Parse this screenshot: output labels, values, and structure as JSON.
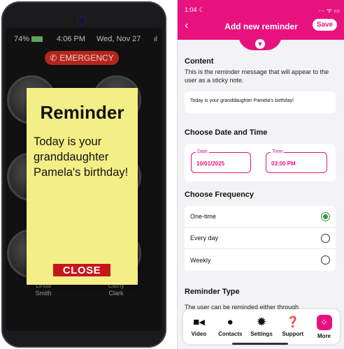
{
  "device": {
    "status": {
      "battery": "74%",
      "time": "4:06 PM",
      "date": "Wed, Nov 27",
      "signal": "ıl"
    },
    "emergency_label": "EMERGENCY",
    "contacts": [
      {
        "name": "Linda\nSmith"
      },
      {
        "name": "Cathy\nClark"
      }
    ],
    "sticky": {
      "title": "Reminder",
      "message": "Today is your granddaughter Pamela's birthday!",
      "close_label": "CLOSE"
    }
  },
  "app": {
    "status_bar": {
      "time": "1:04",
      "icons": "···  ᯤ ▭"
    },
    "header": {
      "back": "‹",
      "title": "Add new reminder",
      "save_label": "Save"
    },
    "content": {
      "title": "Content",
      "desc": "This is the reminder message that will appear to the user as a sticky note.",
      "message": "Today is your granddaughter Pamela's birthday!"
    },
    "datetime": {
      "title": "Choose Date and Time",
      "date_label": "Date",
      "date_value": "10/01/2025",
      "time_label": "Time",
      "time_value": "03:00 PM"
    },
    "frequency": {
      "title": "Choose Frequency",
      "options": [
        {
          "label": "One-time",
          "selected": true
        },
        {
          "label": "Every day",
          "selected": false
        },
        {
          "label": "Weekly",
          "selected": false
        }
      ]
    },
    "reminder_type": {
      "title": "Reminder Type",
      "desc": "The user can be reminded either through"
    },
    "tabbar": [
      {
        "label": "Video",
        "icon": "video-icon"
      },
      {
        "label": "Contacts",
        "icon": "person-icon"
      },
      {
        "label": "Settings",
        "icon": "gear-icon"
      },
      {
        "label": "Support",
        "icon": "help-icon"
      },
      {
        "label": "More",
        "icon": "grid-dots-icon"
      }
    ],
    "colors": {
      "accent": "#e8127f",
      "selected": "#2e9b3a",
      "sticky": "#f4ee86",
      "close": "#c4161c"
    }
  }
}
